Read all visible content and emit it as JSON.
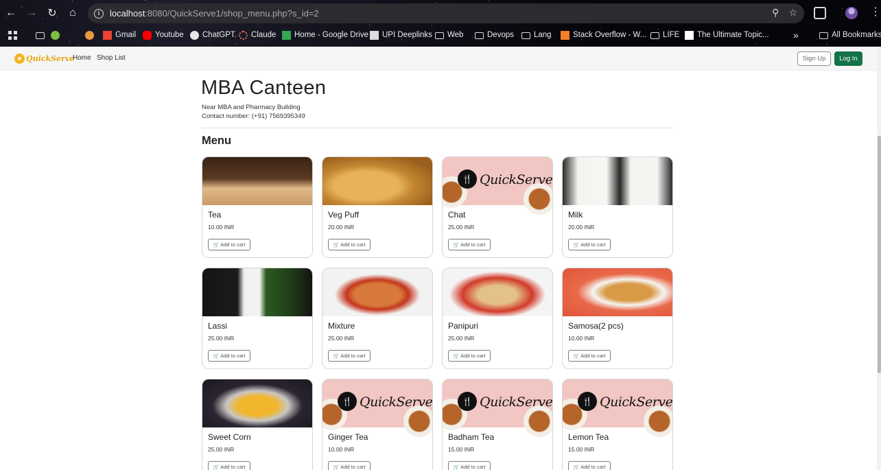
{
  "browser": {
    "url_host": "localhost",
    "url_rest": ":8080/QuickServe1/shop_menu.php?s_id=2",
    "bookmarks": [
      {
        "label": "",
        "icon": "apps-grid-icon"
      },
      {
        "label": "",
        "icon": "folder-icon"
      },
      {
        "label": "",
        "icon": "sprout-icon"
      },
      {
        "label": "",
        "icon": "cookie-icon"
      },
      {
        "label": "Gmail",
        "icon": "gmail-icon"
      },
      {
        "label": "Youtube",
        "icon": "youtube-icon"
      },
      {
        "label": "ChatGPT.",
        "icon": "chatgpt-icon"
      },
      {
        "label": "Claude",
        "icon": "claude-icon"
      },
      {
        "label": "Home - Google Drive",
        "icon": "drive-icon"
      },
      {
        "label": "UPI Deeplinks",
        "icon": "upi-icon"
      },
      {
        "label": "Web",
        "icon": "folder-icon"
      },
      {
        "label": "Devops",
        "icon": "folder-icon"
      },
      {
        "label": "Lang",
        "icon": "folder-icon"
      },
      {
        "label": "Stack Overflow - W...",
        "icon": "stackoverflow-icon"
      },
      {
        "label": "LIFE",
        "icon": "folder-icon"
      },
      {
        "label": "The Ultimate Topic...",
        "icon": "notion-icon"
      },
      {
        "label": "»",
        "icon": "overflow-chevron-icon"
      },
      {
        "label": "All Bookmarks",
        "icon": "folder-icon"
      }
    ]
  },
  "navbar": {
    "brand": "QuickServe",
    "links": [
      "Home",
      "Shop List"
    ],
    "signup_label": "Sign Up",
    "login_label": "Log In",
    "login_color": "#157347"
  },
  "shop": {
    "name": "MBA Canteen",
    "address": "Near MBA and Pharmacy Building",
    "contact": "Contact number: (+91) 7569395349"
  },
  "menu_heading": "Menu",
  "add_to_cart_label": "Add to cart",
  "items": [
    {
      "name": "Tea",
      "price": "10.00 INR",
      "image": "tea-image"
    },
    {
      "name": "Veg Puff",
      "price": "20.00 INR",
      "image": "veg-puff-image"
    },
    {
      "name": "Chat",
      "price": "25.00 INR",
      "image": "quickserve-placeholder-image"
    },
    {
      "name": "Milk",
      "price": "20.00 INR",
      "image": "milk-image"
    },
    {
      "name": "Lassi",
      "price": "25.00 INR",
      "image": "lassi-image"
    },
    {
      "name": "Mixture",
      "price": "25.00 INR",
      "image": "mixture-image"
    },
    {
      "name": "Panipuri",
      "price": "25.00 INR",
      "image": "panipuri-image"
    },
    {
      "name": "Samosa(2 pcs)",
      "price": "10.00 INR",
      "image": "samosa-image"
    },
    {
      "name": "Sweet Corn",
      "price": "25.00 INR",
      "image": "sweet-corn-image"
    },
    {
      "name": "Ginger Tea",
      "price": "10.00 INR",
      "image": "quickserve-placeholder-image"
    },
    {
      "name": "Badham Tea",
      "price": "15.00 INR",
      "image": "quickserve-placeholder-image"
    },
    {
      "name": "Lemon Tea",
      "price": "15.00 INR",
      "image": "quickserve-placeholder-image"
    }
  ],
  "placeholder_logo_text": "QuickServe"
}
